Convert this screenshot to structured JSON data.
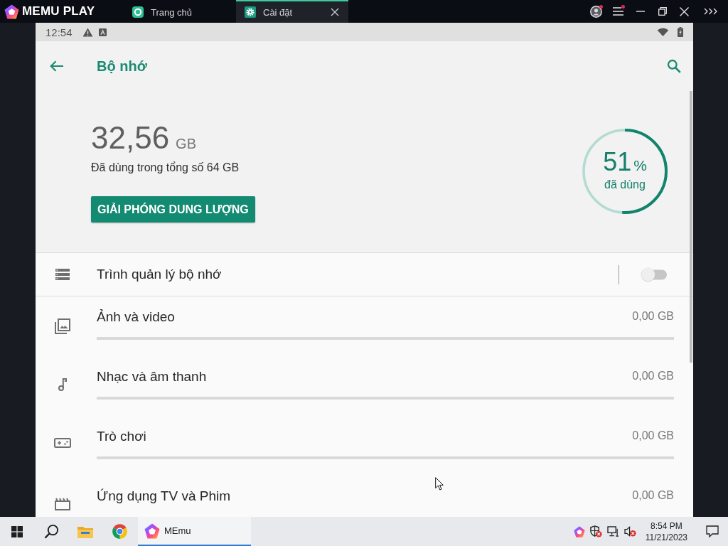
{
  "emulator_bar": {
    "brand": "MEMU PLAY",
    "tabs": [
      {
        "label": "Trang chủ",
        "selected": false
      },
      {
        "label": "Cài đặt",
        "selected": true
      }
    ],
    "account_badge": true,
    "menu_badge": true
  },
  "android_status": {
    "time": "12:54"
  },
  "app_bar": {
    "title": "Bộ nhớ"
  },
  "storage_summary": {
    "used": "32,56",
    "unit": "GB",
    "caption": "Đã dùng trong tổng số 64 GB",
    "free_up_button": "GIẢI PHÓNG DUNG LƯỢNG",
    "usage_ring": {
      "level": 0.51,
      "percent": "51",
      "percent_sign": "%",
      "caption": "đã dùng"
    }
  },
  "storage_items": [
    {
      "kind": "toggle",
      "label": "Trình quản lý bộ nhớ",
      "on": false
    },
    {
      "kind": "usage",
      "label": "Ảnh và video",
      "value": "0,00 GB"
    },
    {
      "kind": "usage",
      "label": "Nhạc và âm thanh",
      "value": "0,00 GB"
    },
    {
      "kind": "usage",
      "label": "Trò chơi",
      "value": "0,00 GB"
    },
    {
      "kind": "usage",
      "label": "Ứng dụng TV và Phim",
      "value": "0,00 GB"
    }
  ],
  "taskbar": {
    "apps": [
      {
        "label": "MEmu",
        "selected": true
      }
    ],
    "clock": {
      "time": "8:54 PM",
      "date": "11/21/2023"
    }
  }
}
